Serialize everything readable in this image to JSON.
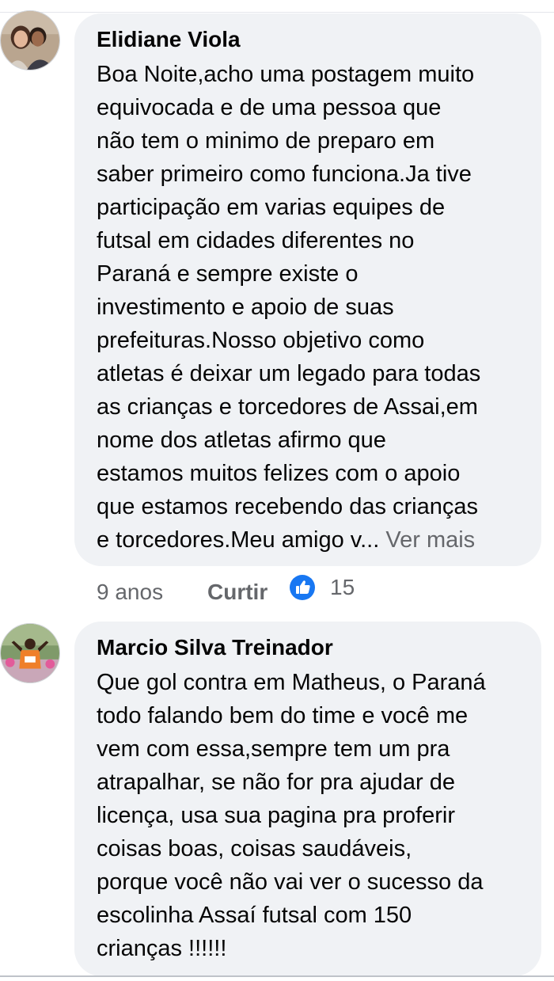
{
  "comments": [
    {
      "author": "Elidiane Viola",
      "lines": [
        "Boa Noite,acho uma postagem muito",
        "equivocada e de uma pessoa que",
        "não tem o minimo de preparo em",
        "saber primeiro como funciona.Ja tive",
        "participação em varias equipes de",
        "futsal em cidades diferentes no",
        "Paraná e sempre existe o",
        "investimento e apoio de suas",
        "prefeituras.Nosso objetivo como",
        "atletas é deixar um legado para todas",
        "as crianças e torcedores de Assai,em",
        "nome dos atletas afirmo que",
        "estamos muitos felizes com o apoio",
        "que estamos recebendo das crianças",
        "e torcedores.Meu amigo v..."
      ],
      "see_more": "Ver mais",
      "time": "9 anos",
      "like_label": "Curtir",
      "like_count": "15"
    },
    {
      "author": "Marcio Silva Treinador",
      "lines": [
        "Que gol contra em Matheus, o Paraná",
        "todo falando bem do time e você me",
        "vem com essa,sempre tem um pra",
        "atrapalhar, se não for pra ajudar de",
        "licença, usa sua pagina pra proferir",
        "coisas boas, coisas saudáveis,",
        "porque você não vai ver o sucesso da",
        "escolinha Assaí futsal com 150",
        "crianças !!!!!!"
      ]
    }
  ],
  "colors": {
    "bubble_bg": "#f0f2f5",
    "text": "#050505",
    "secondary_text": "#65676b",
    "like_blue": "#1877f2"
  }
}
